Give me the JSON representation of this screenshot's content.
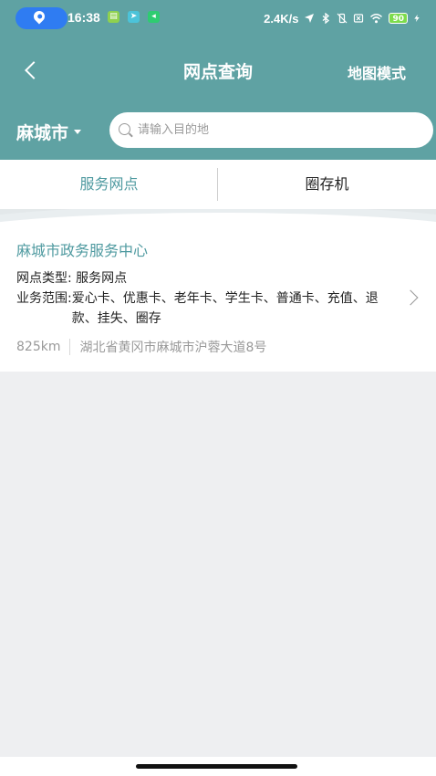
{
  "status_bar": {
    "time": "16:38",
    "network_speed": "2.4K/s",
    "battery": "90",
    "notification_icons": [
      "app-icon",
      "telegram-icon",
      "wechat-icon"
    ]
  },
  "nav": {
    "title": "网点查询",
    "map_mode_label": "地图模式"
  },
  "city_bar": {
    "city": "麻城市",
    "search_placeholder": "请输入目的地",
    "search_value": ""
  },
  "tabs": [
    {
      "label": "服务网点",
      "active": true
    },
    {
      "label": "圈存机",
      "active": false
    }
  ],
  "results": [
    {
      "name": "麻城市政务服务中心",
      "type_label": "网点类型:",
      "type_value": "服务网点",
      "scope_label": "业务范围:",
      "scope_value": "爱心卡、优惠卡、老年卡、学生卡、普通卡、充值、退款、挂失、圈存",
      "distance": "825km",
      "address": "湖北省黄冈市麻城市沪蓉大道8号"
    }
  ],
  "colors": {
    "header": "#5fa2a3",
    "accent": "#4f9aa0",
    "background": "#eeeff1"
  }
}
